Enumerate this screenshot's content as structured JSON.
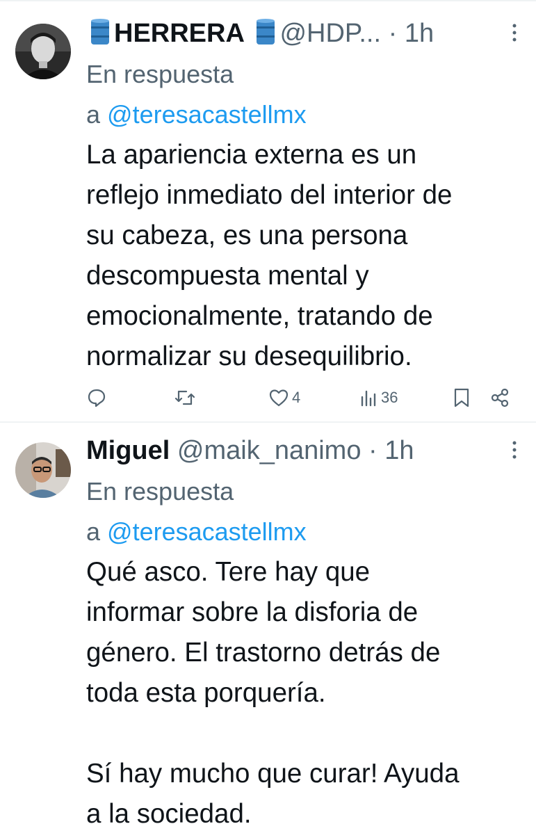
{
  "tweets": [
    {
      "name_prefix_icon": "oil-barrel-icon",
      "name": "HERRERA",
      "name_suffix_icon": "oil-barrel-icon",
      "handle": "@HDP...",
      "dot": "·",
      "time": "1h",
      "reply_prefix": "En respuesta",
      "reply_a": "a ",
      "reply_mention": "@teresacastellmx",
      "text": "La apariencia externa es un\nreflejo inmediato del interior de\nsu cabeza, es una persona\ndescompuesta mental y\nemocionalmente, tratando de\nnormalizar su desequilibrio.",
      "actions": {
        "reply_count": "",
        "retweet_count": "",
        "like_count": "4",
        "views_count": "36"
      }
    },
    {
      "name": "Miguel",
      "handle": "@maik_nanimo",
      "dot": "·",
      "time": "1h",
      "reply_prefix": "En respuesta",
      "reply_a": "a ",
      "reply_mention": "@teresacastellmx",
      "text": "Qué asco. Tere hay que\ninformar sobre la disforia de\ngénero. El trastorno detrás de\ntoda esta porquería.\n\nSí hay mucho que curar! Ayuda\na la sociedad."
    }
  ],
  "colors": {
    "text": "#0f1419",
    "secondary": "#536471",
    "link": "#1d9bf0",
    "barrel": "#3b87c8"
  }
}
